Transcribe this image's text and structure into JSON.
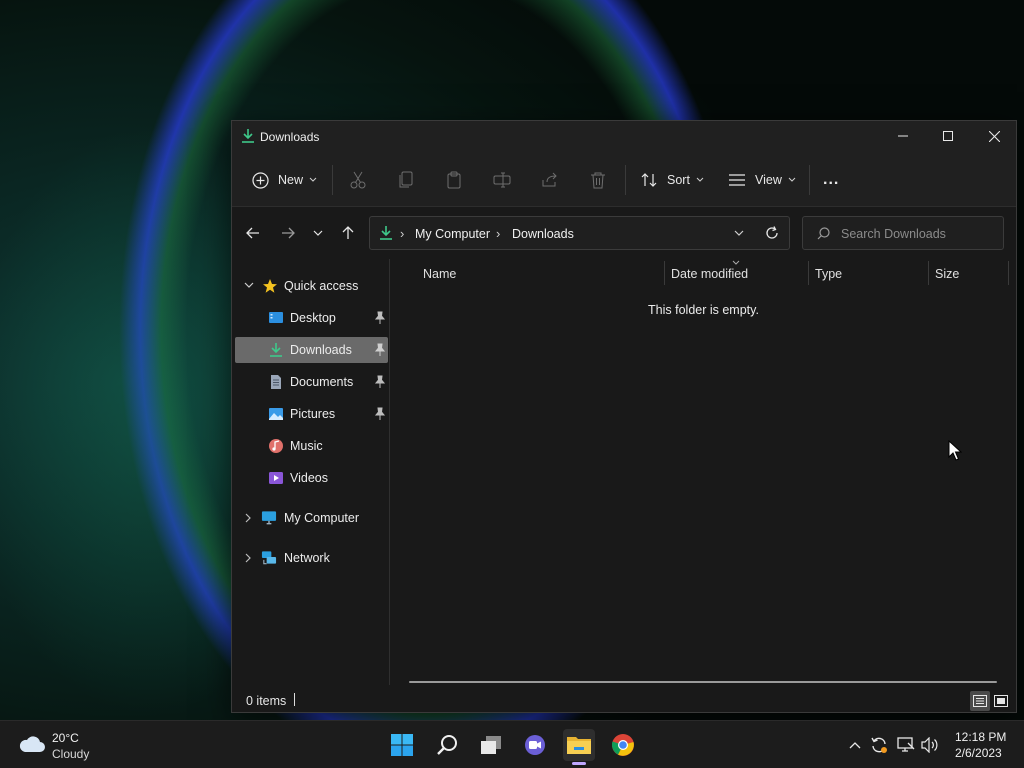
{
  "window": {
    "title": "Downloads"
  },
  "toolbar": {
    "new_label": "New",
    "sort_label": "Sort",
    "view_label": "View",
    "more_label": "..."
  },
  "address": {
    "crumbs": [
      "My Computer",
      "Downloads"
    ]
  },
  "search": {
    "placeholder": "Search Downloads"
  },
  "nav": {
    "quick_access": "Quick access",
    "items": [
      {
        "label": "Desktop",
        "pinned": true
      },
      {
        "label": "Downloads",
        "pinned": true,
        "selected": true
      },
      {
        "label": "Documents",
        "pinned": true
      },
      {
        "label": "Pictures",
        "pinned": true
      },
      {
        "label": "Music",
        "pinned": false
      },
      {
        "label": "Videos",
        "pinned": false
      }
    ],
    "my_computer": "My Computer",
    "network": "Network"
  },
  "content": {
    "columns": [
      "Name",
      "Date modified",
      "Type",
      "Size"
    ],
    "empty_message": "This folder is empty."
  },
  "status": {
    "items_count": "0 items"
  },
  "taskbar": {
    "weather_temp": "20°C",
    "weather_desc": "Cloudy",
    "time": "12:18 PM",
    "date": "2/6/2023"
  },
  "colors": {
    "accent_green": "#3ec98a",
    "window_bg": "#191919",
    "selected_bg": "#6a6a6a"
  }
}
